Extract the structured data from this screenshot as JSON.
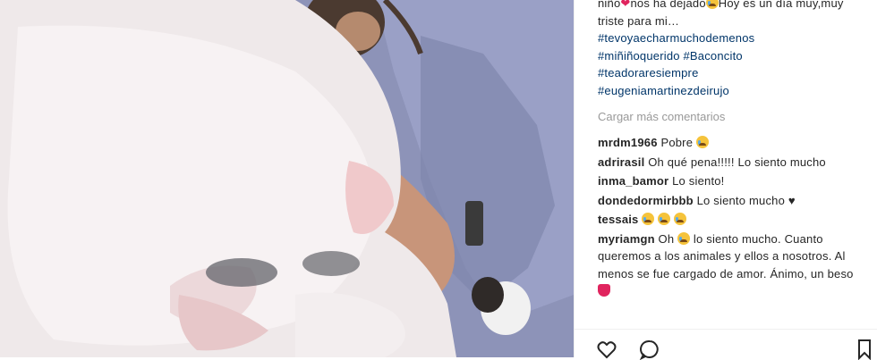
{
  "caption": {
    "text_start": "niño",
    "text_mid": "nos ha dejado",
    "text_end": "Hoy es un día muy,muy triste para mi…",
    "hashtags": [
      "#tevoyaecharmuchodemenos",
      "#miñiñoquerido #Baconcito",
      "#teadoraresiempre",
      "#eugeniamartinezdeirujo"
    ]
  },
  "load_more_label": "Cargar más comentarios",
  "comments": [
    {
      "user": "mrdm1966",
      "text": "Pobre"
    },
    {
      "user": "adrirasil",
      "text": "Oh qué pena!!!!! Lo siento mucho"
    },
    {
      "user": "inma_bamor",
      "text": "Lo siento!"
    },
    {
      "user": "dondedormirbbb",
      "text": "Lo siento mucho ♥"
    },
    {
      "user": "tessais",
      "text": ""
    },
    {
      "user": "myriamgn",
      "text": "Oh",
      "text2": "lo siento mucho. Cuanto queremos a los animales y ellos a nosotros. Al menos se fue cargado de amor. Ánimo, un beso"
    }
  ],
  "icons": {
    "like": "heart-outline-icon",
    "comment": "comment-bubble-icon",
    "save": "bookmark-icon"
  },
  "colors": {
    "text": "#262626",
    "hashtag": "#003569",
    "muted": "#999999",
    "heart": "#e0245e"
  }
}
